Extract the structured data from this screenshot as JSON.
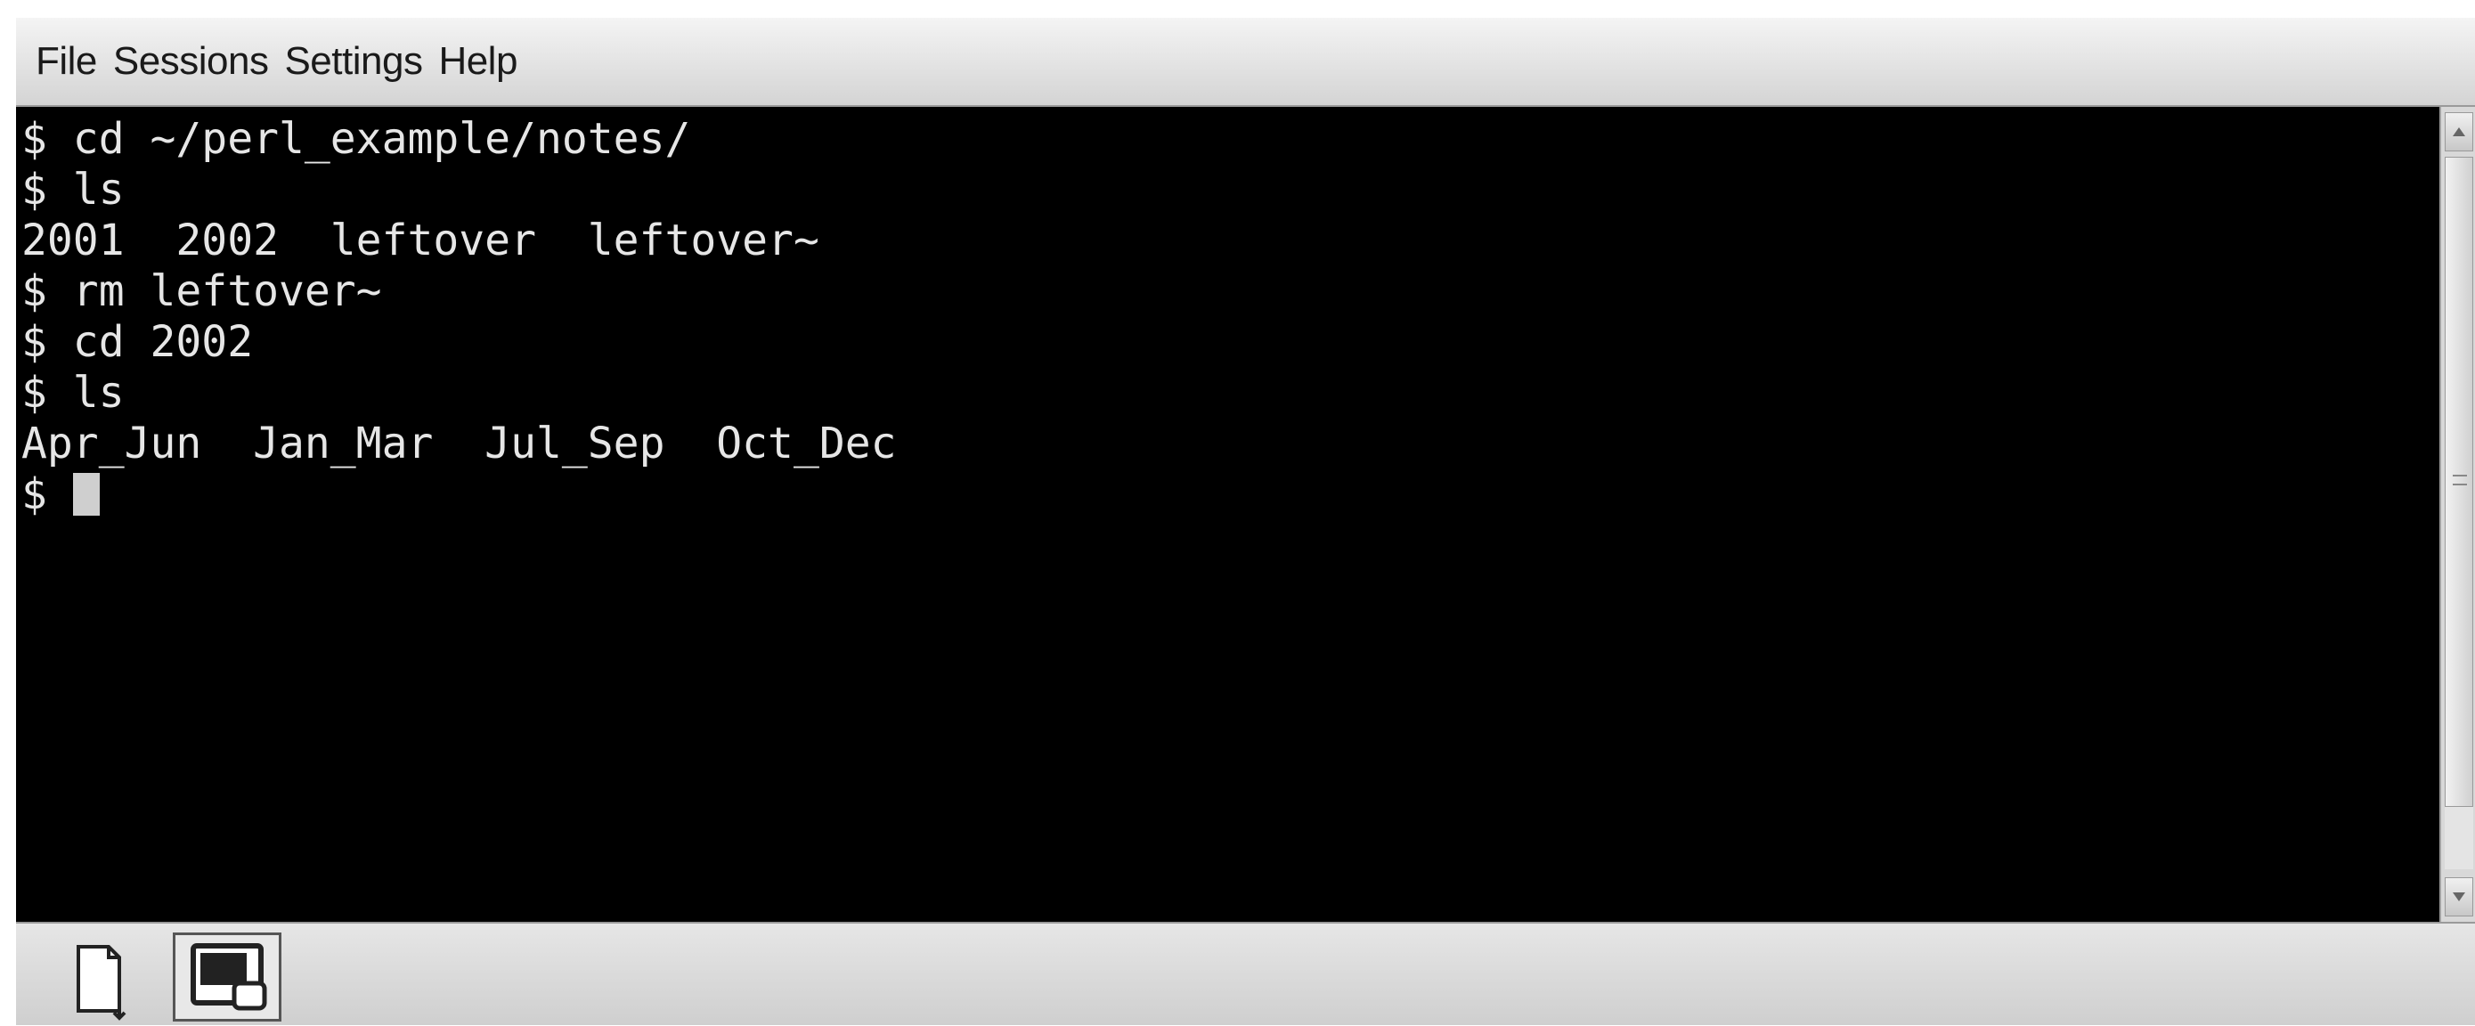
{
  "menubar": {
    "items": [
      {
        "label": "File"
      },
      {
        "label": "Sessions"
      },
      {
        "label": "Settings"
      },
      {
        "label": "Help"
      }
    ]
  },
  "terminal": {
    "lines": [
      "$ cd ~/perl_example/notes/",
      "$ ls",
      "2001  2002  leftover  leftover~",
      "$ rm leftover~",
      "$ cd 2002",
      "$ ls",
      "Apr_Jun  Jan_Mar  Jul_Sep  Oct_Dec"
    ],
    "prompt": "$ "
  },
  "bottombar": {
    "new_session_icon": "new-document-icon",
    "session_tab_icon": "terminal-session-icon"
  },
  "colors": {
    "terminal_bg": "#000000",
    "terminal_fg": "#e6e6e6",
    "chrome_bg": "#d4d4d4"
  }
}
